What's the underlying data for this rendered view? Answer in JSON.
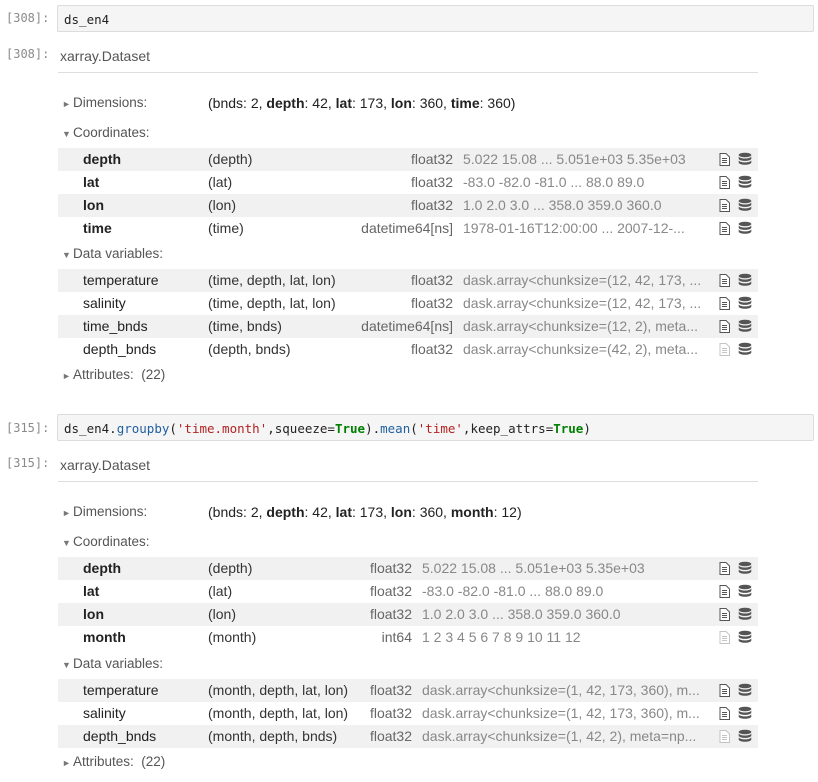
{
  "cells": [
    {
      "prompt_in": "[308]:",
      "prompt_out": "[308]:",
      "code": "ds_en4",
      "dataset_title": "xarray.Dataset",
      "dims_label": "Dimensions:",
      "dims": [
        {
          "name": "bnds",
          "size": "2",
          "bold": false
        },
        {
          "name": "depth",
          "size": "42",
          "bold": true
        },
        {
          "name": "lat",
          "size": "173",
          "bold": true
        },
        {
          "name": "lon",
          "size": "360",
          "bold": true
        },
        {
          "name": "time",
          "size": "360",
          "bold": true
        }
      ],
      "coords_label": "Coordinates:",
      "coords": [
        {
          "name": "depth",
          "dims": "(depth)",
          "dtype": "float32",
          "preview": "5.022 15.08 ... 5.051e+03 5.35e+03",
          "attrs_icon": "file-icon-active"
        },
        {
          "name": "lat",
          "dims": "(lat)",
          "dtype": "float32",
          "preview": "-83.0 -82.0 -81.0 ... 88.0 89.0",
          "attrs_icon": "file-icon-active"
        },
        {
          "name": "lon",
          "dims": "(lon)",
          "dtype": "float32",
          "preview": "1.0 2.0 3.0 ... 358.0 359.0 360.0",
          "attrs_icon": "file-icon-active"
        },
        {
          "name": "time",
          "dims": "(time)",
          "dtype": "datetime64[ns]",
          "preview": "1978-01-16T12:00:00 ... 2007-12-...",
          "attrs_icon": "file-icon-active"
        }
      ],
      "vars_label": "Data variables:",
      "vars": [
        {
          "name": "temperature",
          "dims": "(time, depth, lat, lon)",
          "dtype": "float32",
          "preview": "dask.array<chunksize=(12, 42, 173, ...",
          "attrs_icon": "file-icon-active"
        },
        {
          "name": "salinity",
          "dims": "(time, depth, lat, lon)",
          "dtype": "float32",
          "preview": "dask.array<chunksize=(12, 42, 173, ...",
          "attrs_icon": "file-icon-active"
        },
        {
          "name": "time_bnds",
          "dims": "(time, bnds)",
          "dtype": "datetime64[ns]",
          "preview": "dask.array<chunksize=(12, 2), meta...",
          "attrs_icon": "file-icon-active"
        },
        {
          "name": "depth_bnds",
          "dims": "(depth, bnds)",
          "dtype": "float32",
          "preview": "dask.array<chunksize=(42, 2), meta...",
          "attrs_icon": "file-icon-disabled"
        }
      ],
      "attrs_label": "Attributes:",
      "attrs_count": "(22)"
    },
    {
      "prompt_in": "[315]:",
      "prompt_out": "[315]:",
      "code_parts": {
        "a": "ds_en4.",
        "b": "groupby",
        "c": "(",
        "d": "'time.month'",
        "e": ",squeeze=",
        "f": "True",
        "g": ").",
        "h": "mean",
        "i": "(",
        "j": "'time'",
        "k": ",keep_attrs=",
        "l": "True",
        "m": ")"
      },
      "dataset_title": "xarray.Dataset",
      "dims_label": "Dimensions:",
      "dims": [
        {
          "name": "bnds",
          "size": "2",
          "bold": false
        },
        {
          "name": "depth",
          "size": "42",
          "bold": true
        },
        {
          "name": "lat",
          "size": "173",
          "bold": true
        },
        {
          "name": "lon",
          "size": "360",
          "bold": true
        },
        {
          "name": "month",
          "size": "12",
          "bold": true
        }
      ],
      "coords_label": "Coordinates:",
      "coords": [
        {
          "name": "depth",
          "dims": "(depth)",
          "dtype": "float32",
          "preview": "5.022 15.08 ... 5.051e+03 5.35e+03",
          "attrs_icon": "file-icon-active"
        },
        {
          "name": "lat",
          "dims": "(lat)",
          "dtype": "float32",
          "preview": "-83.0 -82.0 -81.0 ... 88.0 89.0",
          "attrs_icon": "file-icon-active"
        },
        {
          "name": "lon",
          "dims": "(lon)",
          "dtype": "float32",
          "preview": "1.0 2.0 3.0 ... 358.0 359.0 360.0",
          "attrs_icon": "file-icon-active"
        },
        {
          "name": "month",
          "dims": "(month)",
          "dtype": "int64",
          "preview": "1 2 3 4 5 6 7 8 9 10 11 12",
          "attrs_icon": "file-icon-disabled"
        }
      ],
      "vars_label": "Data variables:",
      "vars": [
        {
          "name": "temperature",
          "dims": "(month, depth, lat, lon)",
          "dtype": "float32",
          "preview": "dask.array<chunksize=(1, 42, 173, 360), m...",
          "attrs_icon": "file-icon-active"
        },
        {
          "name": "salinity",
          "dims": "(month, depth, lat, lon)",
          "dtype": "float32",
          "preview": "dask.array<chunksize=(1, 42, 173, 360), m...",
          "attrs_icon": "file-icon-active"
        },
        {
          "name": "depth_bnds",
          "dims": "(month, depth, bnds)",
          "dtype": "float32",
          "preview": "dask.array<chunksize=(1, 42, 2), meta=np...",
          "attrs_icon": "file-icon-disabled"
        }
      ],
      "attrs_label": "Attributes:",
      "attrs_count": "(22)"
    }
  ],
  "icons": {
    "collapsed_triangle": "►",
    "expanded_triangle": "▼",
    "attrs_icon": "file-icon",
    "data_icon": "database-icon"
  }
}
